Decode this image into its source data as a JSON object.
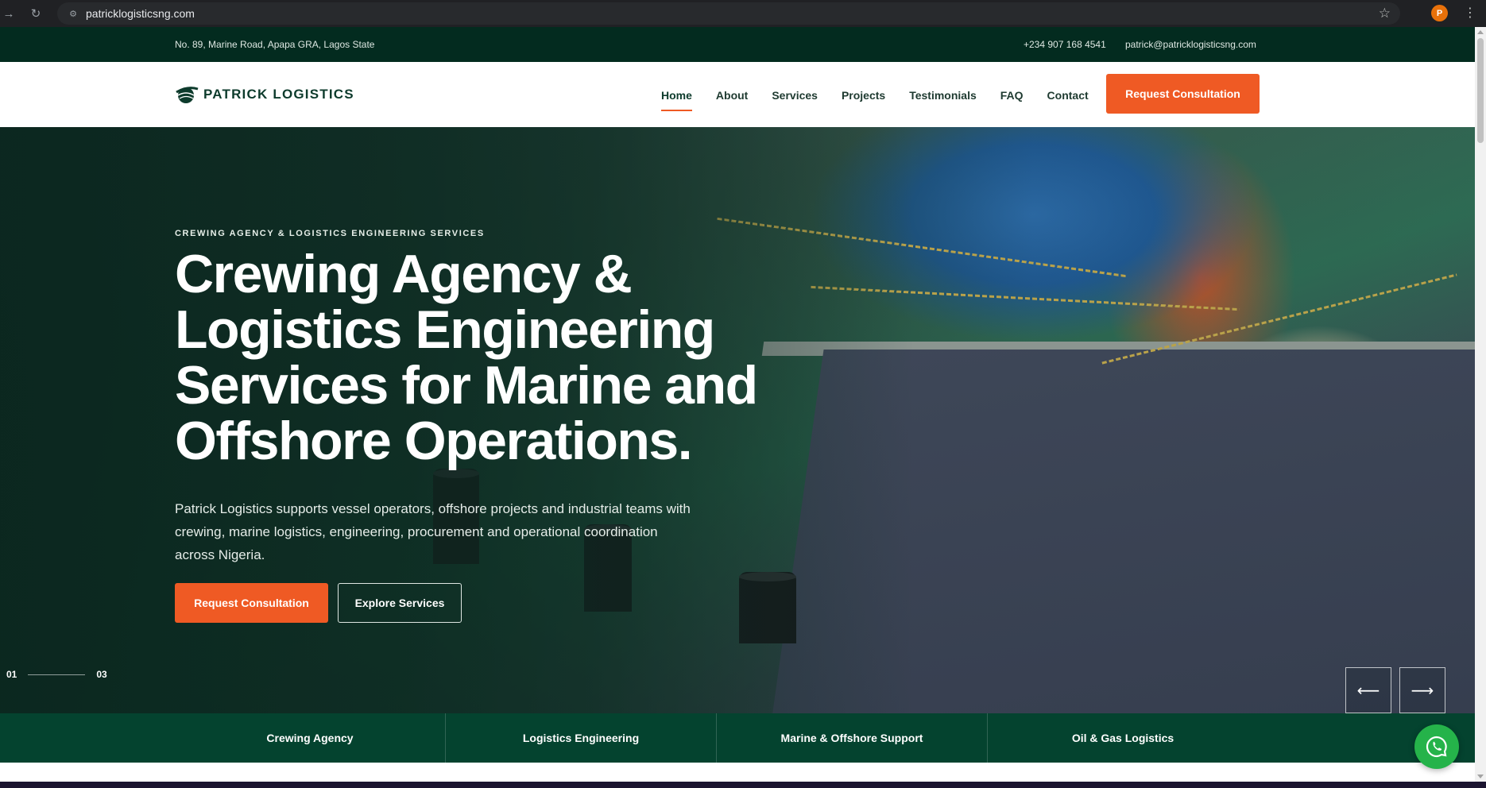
{
  "browser": {
    "url": "patricklogisticsng.com",
    "profile_initial": "P"
  },
  "topbar": {
    "address": "No. 89, Marine Road, Apapa GRA, Lagos State",
    "phone": "+234 907 168 4541",
    "email": "patrick@patricklogisticsng.com"
  },
  "header": {
    "brand": "PATRICK LOGISTICS",
    "nav": [
      "Home",
      "About",
      "Services",
      "Projects",
      "Testimonials",
      "FAQ",
      "Contact"
    ],
    "active_nav": "Home",
    "cta": "Request Consultation"
  },
  "hero": {
    "eyebrow": "CREWING AGENCY & LOGISTICS ENGINEERING SERVICES",
    "headline": "Crewing Agency & Logistics Engineering Services for Marine and Offshore Operations.",
    "lead": "Patrick Logistics supports vessel operators, offshore projects and industrial teams with crewing, marine logistics, engineering, procurement and operational coordination across Nigeria.",
    "primary_button": "Request Consultation",
    "secondary_button": "Explore Services",
    "slide_current": "01",
    "slide_total": "03"
  },
  "services_strip": [
    "Crewing Agency",
    "Logistics Engineering",
    "Marine & Offshore Support",
    "Oil & Gas Logistics"
  ],
  "colors": {
    "brand_dark": "#032b1f",
    "strip_green": "#04432f",
    "accent_orange": "#ef5a24",
    "whatsapp_green": "#25b34a"
  }
}
